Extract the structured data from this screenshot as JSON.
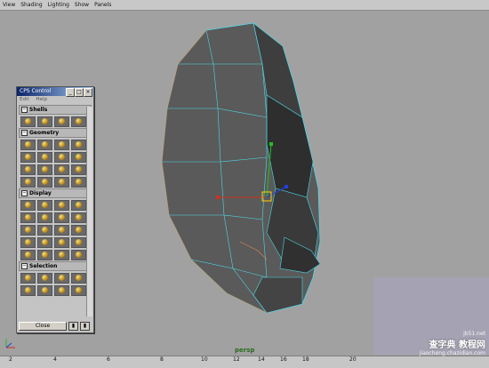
{
  "menubar": {
    "items": [
      "View",
      "Shading",
      "Lighting",
      "Show",
      "Panels"
    ]
  },
  "viewport": {
    "camera": "persp"
  },
  "cps": {
    "title": "CPS Control",
    "menu": [
      "Edit",
      "Help"
    ],
    "sections": [
      "Shells",
      "Geometry",
      "Display",
      "Selection"
    ],
    "close_label": "Close"
  },
  "timeline": {
    "labels": [
      "2",
      "4",
      "6",
      "8",
      "10",
      "12",
      "14",
      "16",
      "18",
      "20"
    ]
  },
  "watermark": {
    "line1": "查字典 教程网",
    "line2": "jiaocheng.chazidian.com",
    "site": "jb51.net"
  },
  "colors": {
    "viewport_bg": "#a1a1a1",
    "mesh_face": "#555555",
    "wire_edge": "#4fd8e8",
    "wire_orange": "#e08850"
  }
}
